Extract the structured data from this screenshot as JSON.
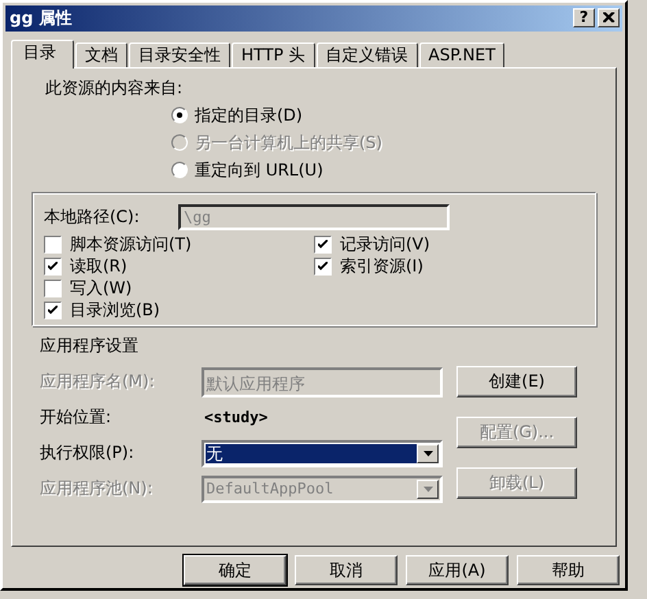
{
  "window": {
    "title": "gg 属性",
    "help_button": "?"
  },
  "tabs": [
    {
      "label": "目录",
      "selected": true
    },
    {
      "label": "文档",
      "selected": false
    },
    {
      "label": "目录安全性",
      "selected": false
    },
    {
      "label": "HTTP 头",
      "selected": false
    },
    {
      "label": "自定义错误",
      "selected": false
    },
    {
      "label": "ASP.NET",
      "selected": false
    }
  ],
  "source": {
    "label": "此资源的内容来自:",
    "options": [
      {
        "label": "指定的目录(D)",
        "selected": true,
        "disabled": false
      },
      {
        "label": "另一台计算机上的共享(S)",
        "selected": false,
        "disabled": true
      },
      {
        "label": "重定向到 URL(U)",
        "selected": false,
        "disabled": false
      }
    ]
  },
  "local_path": {
    "label": "本地路径(C):",
    "value": "\\gg",
    "disabled": true
  },
  "permissions_left": [
    {
      "label": "脚本资源访问(T)",
      "checked": false
    },
    {
      "label": "读取(R)",
      "checked": true
    },
    {
      "label": "写入(W)",
      "checked": false
    },
    {
      "label": "目录浏览(B)",
      "checked": true
    }
  ],
  "permissions_right": [
    {
      "label": "记录访问(V)",
      "checked": true
    },
    {
      "label": "索引资源(I)",
      "checked": true
    }
  ],
  "app_settings": {
    "heading": "应用程序设置",
    "rows": [
      {
        "kind": "field",
        "label": "应用程序名(M):",
        "value": "默认应用程序",
        "disabled": true
      },
      {
        "kind": "text",
        "label": "开始位置:",
        "value": "<study>",
        "disabled": false
      },
      {
        "kind": "select",
        "label": "执行权限(P):",
        "value": "无",
        "disabled": false,
        "focused": true
      },
      {
        "kind": "select",
        "label": "应用程序池(N):",
        "value": "DefaultAppPool",
        "disabled": true,
        "focused": false
      }
    ],
    "buttons": [
      {
        "label": "创建(E)",
        "disabled": false
      },
      {
        "label": "配置(G)...",
        "disabled": true
      },
      {
        "label": "卸载(L)",
        "disabled": true
      }
    ]
  },
  "footer_buttons": [
    {
      "label": "确定",
      "default": true
    },
    {
      "label": "取消",
      "default": false
    },
    {
      "label": "应用(A)",
      "default": false
    },
    {
      "label": "帮助",
      "default": false
    }
  ]
}
